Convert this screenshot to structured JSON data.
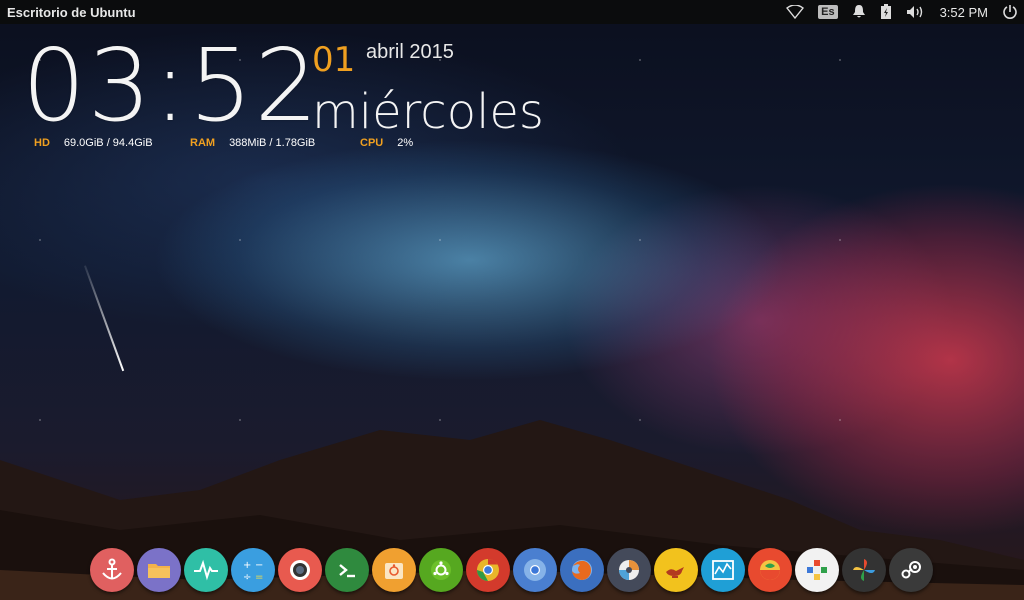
{
  "panel": {
    "title": "Escritorio de Ubuntu",
    "lang": "Es",
    "time": "3:52 PM",
    "icons": [
      "wifi-icon",
      "language-indicator",
      "notification-bell-icon",
      "battery-icon",
      "volume-icon",
      "power-icon"
    ]
  },
  "conky": {
    "time": "03:52",
    "day": "01",
    "month_year": "abril 2015",
    "weekday": "miércoles",
    "stats": {
      "hd_label": "HD",
      "hd_value": "69.0GiB / 94.4GiB",
      "ram_label": "RAM",
      "ram_value": "388MiB / 1.78GiB",
      "cpu_label": "CPU",
      "cpu_value": "2%"
    },
    "accent": "#f0a020"
  },
  "dock": {
    "items": [
      {
        "name": "anchor-app-icon",
        "color": "#e06060"
      },
      {
        "name": "files-folder-icon",
        "color": "#7b72c8"
      },
      {
        "name": "system-monitor-icon",
        "color": "#2fbfa6"
      },
      {
        "name": "calculator-icon",
        "color": "#3a9ee0"
      },
      {
        "name": "camera-icon",
        "color": "#e85a4f"
      },
      {
        "name": "terminal-icon",
        "color": "#2f8a3e"
      },
      {
        "name": "ubuntu-software-center-icon",
        "color": "#f0a030"
      },
      {
        "name": "ubuntu-tweak-icon",
        "color": "#56a820"
      },
      {
        "name": "chrome-icon",
        "color": "#d33a2c"
      },
      {
        "name": "chromium-icon",
        "color": "#4a7fd0"
      },
      {
        "name": "firefox-icon",
        "color": "#3b6fbf"
      },
      {
        "name": "disk-tool-icon",
        "color": "#444a5a"
      },
      {
        "name": "genie-lamp-icon",
        "color": "#f2c21d"
      },
      {
        "name": "monitor-chart-icon",
        "color": "#1f9fd6"
      },
      {
        "name": "rhythmbox-icon",
        "color": "#e84a2f"
      },
      {
        "name": "plus-app-icon",
        "color": "#f2f2f2"
      },
      {
        "name": "pinwheel-icon",
        "color": "#333"
      },
      {
        "name": "steam-icon",
        "color": "#3a3a3a"
      }
    ]
  }
}
